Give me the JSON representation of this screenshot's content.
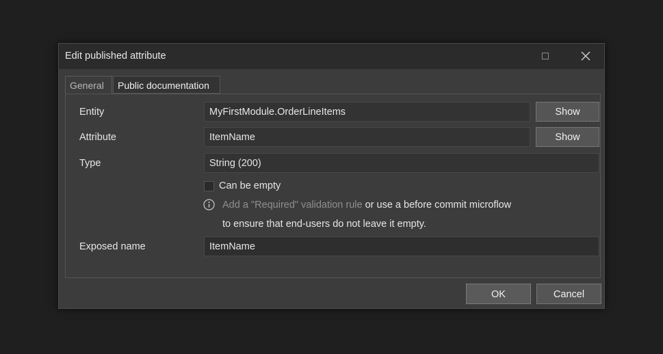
{
  "dialog": {
    "title": "Edit published attribute"
  },
  "tabs": [
    {
      "label": "General"
    },
    {
      "label": "Public documentation"
    }
  ],
  "form": {
    "entity": {
      "label": "Entity",
      "value": "MyFirstModule.OrderLineItems",
      "button": "Show"
    },
    "attribute": {
      "label": "Attribute",
      "value": "ItemName",
      "button": "Show"
    },
    "type": {
      "label": "Type",
      "value": "String (200)"
    },
    "can_be_empty": {
      "label": "Can be empty",
      "checked": false
    },
    "info": {
      "link_text": "Add a \"Required\" validation rule",
      "line1_rest": " or use a before commit microflow",
      "line2": "to ensure that end-users do not leave it empty."
    },
    "exposed_name": {
      "label": "Exposed name",
      "value": "ItemName"
    }
  },
  "footer": {
    "ok_label": "OK",
    "cancel_label": "Cancel"
  },
  "icons": {
    "maximize": "maximize-icon",
    "close": "close-icon",
    "info": "info-icon"
  }
}
